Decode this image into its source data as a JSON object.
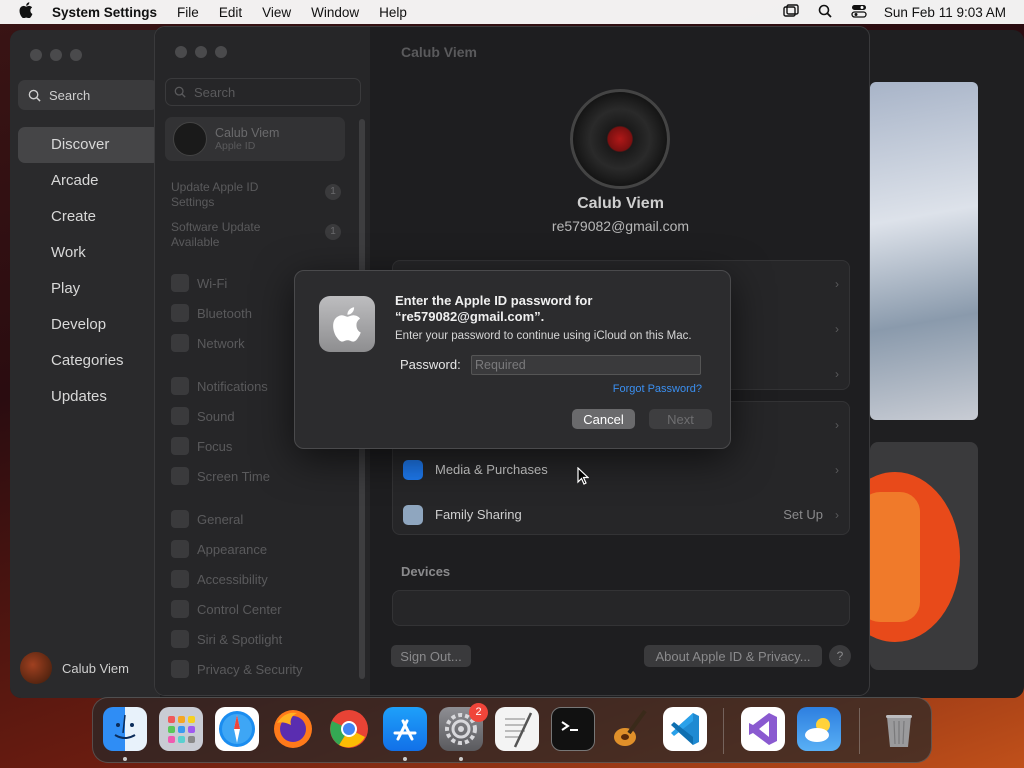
{
  "menubar": {
    "app_name": "System Settings",
    "items": [
      "File",
      "Edit",
      "View",
      "Window",
      "Help"
    ],
    "clock": "Sun Feb 11  9:03 AM"
  },
  "appstore": {
    "search_label": "Search",
    "nav": [
      "Discover",
      "Arcade",
      "Create",
      "Work",
      "Play",
      "Develop",
      "Categories",
      "Updates"
    ],
    "active_nav": "Discover",
    "user_name": "Calub Viem"
  },
  "settings_sidebar": {
    "search_placeholder": "Search",
    "account_name": "Calub Viem",
    "account_sub": "Apple ID",
    "updates": [
      {
        "label": "Update Apple ID Settings",
        "count": "1"
      },
      {
        "label": "Software Update Available",
        "count": "1"
      }
    ],
    "group1": [
      "Wi-Fi",
      "Bluetooth",
      "Network"
    ],
    "group2": [
      "Notifications",
      "Sound",
      "Focus",
      "Screen Time"
    ],
    "group3": [
      "General",
      "Appearance",
      "Accessibility",
      "Control Center",
      "Siri & Spotlight",
      "Privacy & Security"
    ]
  },
  "settings_main": {
    "header": "Calub Viem",
    "name": "Calub Viem",
    "email": "re579082@gmail.com",
    "media_purchases": "Media & Purchases",
    "family_sharing": "Family Sharing",
    "family_value": "Set Up",
    "devices_heading": "Devices",
    "sign_out": "Sign Out...",
    "about": "About Apple ID & Privacy...",
    "help": "?"
  },
  "dialog": {
    "title": "Enter the Apple ID password for “re579082@gmail.com”.",
    "subtitle": "Enter your password to continue using iCloud on this Mac.",
    "password_label": "Password:",
    "password_placeholder": "Required",
    "forgot": "Forgot Password?",
    "cancel": "Cancel",
    "next": "Next"
  },
  "dock": {
    "apps": [
      "Finder",
      "Launchpad",
      "Safari",
      "Firefox",
      "Chrome",
      "App Store",
      "System Settings",
      "TextEdit",
      "Terminal",
      "GarageBand",
      "Visual Studio Code",
      "Visual Studio",
      "Weather",
      "Trash"
    ],
    "settings_badge": "2"
  },
  "colors": {
    "accent_link": "#3b8ff0",
    "badge_red": "#f0453a"
  }
}
